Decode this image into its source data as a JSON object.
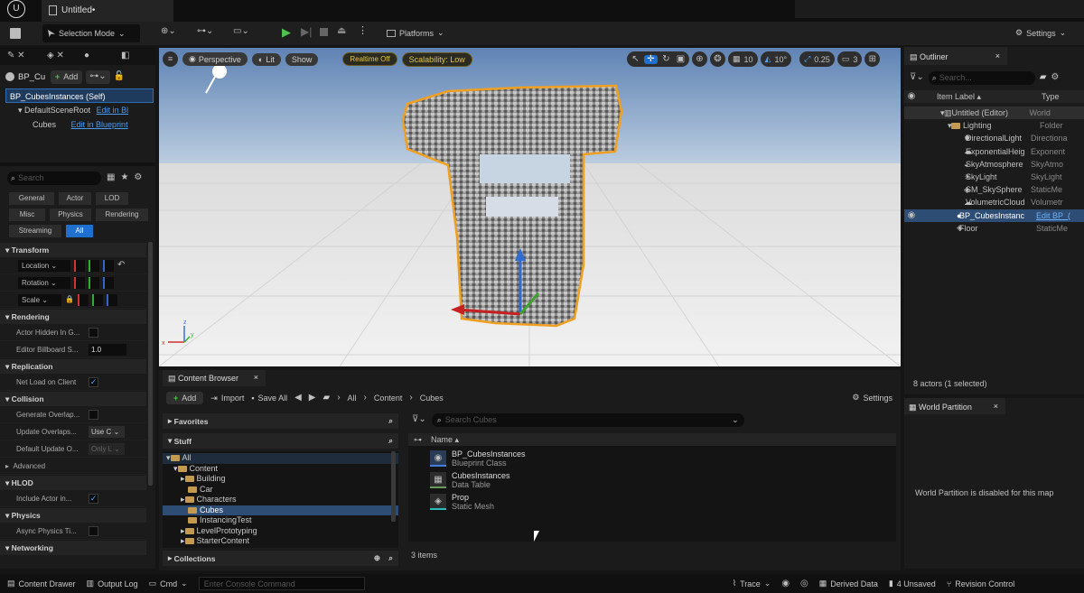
{
  "title_tab": "Untitled•",
  "toolbar": {
    "selection_mode": "Selection Mode",
    "platforms": "Platforms",
    "settings": "Settings"
  },
  "details": {
    "bp_short": "BP_Cu",
    "add": "Add",
    "root_item": "BP_CubesInstances (Self)",
    "scene_root": "DefaultSceneRoot",
    "scene_root_link": "Edit in Bl",
    "cubes": "Cubes",
    "cubes_link": "Edit in Blueprint",
    "search_placeholder": "Search",
    "filters": [
      "General",
      "Actor",
      "LOD",
      "Misc",
      "Physics",
      "Rendering",
      "Streaming",
      "All"
    ],
    "sections": {
      "transform": "Transform",
      "location": "Location",
      "rotation": "Rotation",
      "scale": "Scale",
      "rendering": "Rendering",
      "actor_hidden": "Actor Hidden In G...",
      "editor_billboard": "Editor Billboard S...",
      "billboard_value": "1.0",
      "replication": "Replication",
      "net_load": "Net Load on Client",
      "collision": "Collision",
      "gen_overlap": "Generate Overlap...",
      "update_overlaps": "Update Overlaps...",
      "update_overlaps_val": "Use C",
      "default_update": "Default Update O...",
      "default_update_val": "Only L",
      "advanced": "Advanced",
      "hlod": "HLOD",
      "include_actor": "Include Actor in...",
      "physics": "Physics",
      "async_physics": "Async Physics Ti...",
      "networking": "Networking"
    }
  },
  "viewport": {
    "perspective": "Perspective",
    "lit": "Lit",
    "show": "Show",
    "realtime": "Realtime Off",
    "scalability": "Scalability: Low",
    "grid": "10",
    "angle": "10°",
    "scale_snap": "0.25",
    "cam_speed": "3"
  },
  "outliner": {
    "tab": "Outliner",
    "search_placeholder": "Search...",
    "col_label": "Item Label ▴",
    "col_type": "Type",
    "items": [
      {
        "label": "Untitled (Editor)",
        "type": "World"
      },
      {
        "label": "Lighting",
        "type": "Folder"
      },
      {
        "label": "DirectionalLight",
        "type": "Directiona"
      },
      {
        "label": "ExponentialHeig",
        "type": "Exponent"
      },
      {
        "label": "SkyAtmosphere",
        "type": "SkyAtmo"
      },
      {
        "label": "SkyLight",
        "type": "SkyLight"
      },
      {
        "label": "SM_SkySphere",
        "type": "StaticMe"
      },
      {
        "label": "VolumetricCloud",
        "type": "Volumetr"
      },
      {
        "label": "BP_CubesInstanc",
        "type": "Edit BP_("
      },
      {
        "label": "Floor",
        "type": "StaticMe"
      }
    ],
    "status": "8 actors (1 selected)"
  },
  "world_partition": {
    "tab": "World Partition",
    "message": "World Partition is disabled for this map"
  },
  "content_browser": {
    "tab": "Content Browser",
    "add": "Add",
    "import": "Import",
    "save_all": "Save All",
    "path": [
      "All",
      "Content",
      "Cubes"
    ],
    "settings": "Settings",
    "favorites": "Favorites",
    "stuff": "Stuff",
    "folders": [
      "All",
      "Content",
      "Building",
      "Car",
      "Characters",
      "Cubes",
      "InstancingTest",
      "LevelPrototyping",
      "StarterContent"
    ],
    "search_placeholder": "Search Cubes",
    "name_col": "Name ▴",
    "assets": [
      {
        "name": "BP_CubesInstances",
        "type": "Blueprint Class"
      },
      {
        "name": "CubesInstances",
        "type": "Data Table"
      },
      {
        "name": "Prop",
        "type": "Static Mesh"
      }
    ],
    "collections": "Collections",
    "count": "3 items"
  },
  "statusbar": {
    "content_drawer": "Content Drawer",
    "output_log": "Output Log",
    "cmd": "Cmd",
    "console_placeholder": "Enter Console Command",
    "trace": "Trace",
    "derived": "Derived Data",
    "unsaved": "4 Unsaved",
    "revision": "Revision Control"
  }
}
